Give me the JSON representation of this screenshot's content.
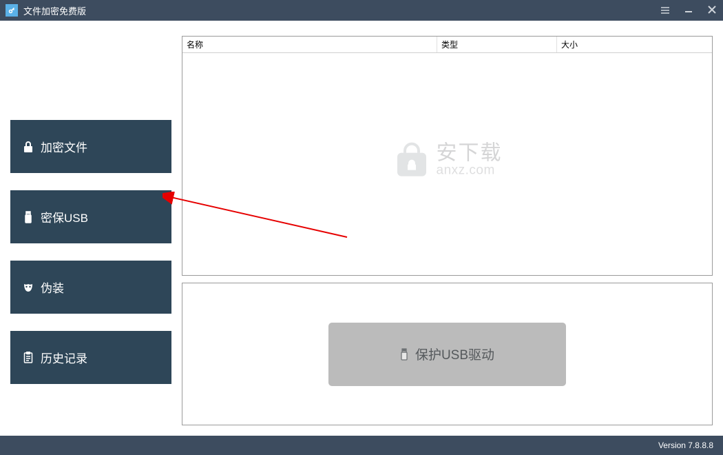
{
  "titlebar": {
    "title": "文件加密免费版"
  },
  "sidebar": {
    "items": [
      {
        "label": "加密文件",
        "icon": "lock-icon"
      },
      {
        "label": "密保USB",
        "icon": "usb-icon"
      },
      {
        "label": "伪装",
        "icon": "mask-icon"
      },
      {
        "label": "历史记录",
        "icon": "clipboard-icon"
      }
    ]
  },
  "table": {
    "columns": {
      "name": "名称",
      "type": "类型",
      "size": "大小"
    }
  },
  "watermark": {
    "cn": "安下载",
    "en": "anxz.com"
  },
  "action": {
    "protect_label": "保护USB驱动"
  },
  "footer": {
    "version": "Version 7.8.8.8"
  }
}
